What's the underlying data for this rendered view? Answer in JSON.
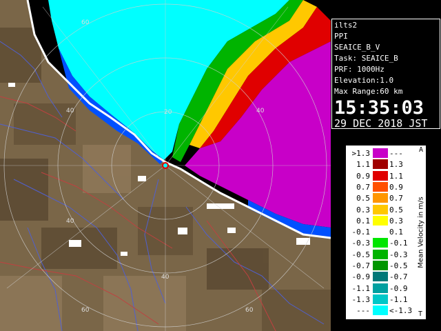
{
  "info": {
    "radar": "ilts2",
    "mode": "PPI",
    "product": "SEAICE_B_V",
    "task": "Task: SEAICE_B",
    "prf": "PRF: 1000Hz",
    "elevation": "Elevation:1.0",
    "max_range": "Max Range:60 km",
    "time": "15:35:03",
    "date": "29 DEC 2018 JST"
  },
  "map": {
    "range_ring_labels": [
      "20",
      "40",
      "60",
      "40",
      "40",
      "40",
      "60",
      "60"
    ]
  },
  "legend": {
    "title": "Mean Velocity in m/s",
    "top_mark": "A",
    "bottom_mark": "T",
    "rows": [
      {
        "left": ">1.3",
        "right": "---",
        "color": "#c800c8"
      },
      {
        "left": "1.1",
        "right": "1.3",
        "color": "#a00000"
      },
      {
        "left": "0.9",
        "right": "1.1",
        "color": "#e00000"
      },
      {
        "left": "0.7",
        "right": "0.9",
        "color": "#ff5000"
      },
      {
        "left": "0.5",
        "right": "0.7",
        "color": "#ff9600"
      },
      {
        "left": "0.3",
        "right": "0.5",
        "color": "#ffc800"
      },
      {
        "left": "0.1",
        "right": "0.3",
        "color": "#ffff00"
      },
      {
        "left": "-0.1",
        "right": "0.1",
        "color": "#ffffff"
      },
      {
        "left": "-0.3",
        "right": "-0.1",
        "color": "#00e600"
      },
      {
        "left": "-0.5",
        "right": "-0.3",
        "color": "#00b400"
      },
      {
        "left": "-0.7",
        "right": "-0.5",
        "color": "#009600"
      },
      {
        "left": "-0.9",
        "right": "-0.7",
        "color": "#007878"
      },
      {
        "left": "-1.1",
        "right": "-0.9",
        "color": "#00a0a0"
      },
      {
        "left": "-1.3",
        "right": "-1.1",
        "color": "#00c8c8"
      },
      {
        "left": "---",
        "right": "<-1.3",
        "color": "#00ffff"
      }
    ]
  },
  "colors": {
    "land": "#7a6648",
    "sea_echo_approach": "#00ffff",
    "sea_echo_recede": "#c800c8",
    "river": "#5060d0",
    "boundary": "#c04040"
  }
}
